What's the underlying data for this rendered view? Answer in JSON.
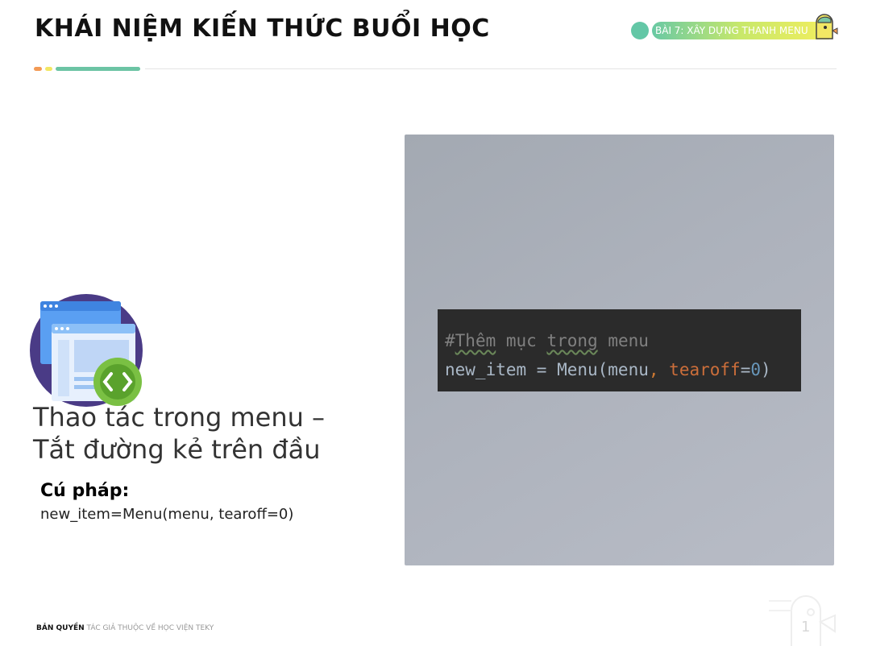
{
  "header": {
    "title": "KHÁI NIỆM KIẾN THỨC BUỔI HỌC",
    "lesson_tag": "BÀI 7: XÂY DỰNG THANH MENU"
  },
  "main": {
    "heading_line1": "Thao tác trong menu –",
    "heading_line2": "Tắt đường kẻ trên đầu",
    "syntax_label": "Cú pháp:",
    "syntax_code": "new_item=Menu(menu, tearoff=0)"
  },
  "code_block": {
    "line1_hash": "#",
    "line1_w1": "Thêm",
    "line1_w2": " mục ",
    "line1_w3": "trong",
    "line1_w4": " menu",
    "line2_a": "new_item = Menu(menu",
    "line2_comma": ",",
    "line2_kw": " tearoff",
    "line2_eq": "=",
    "line2_num": "0",
    "line2_close": ")"
  },
  "footer": {
    "bold": "BẢN QUYỀN",
    "rest": " TÁC GIẢ THUỘC VỀ HỌC VIỆN TEKY",
    "page_number": "1"
  },
  "colors": {
    "accent_orange": "#f39a55",
    "accent_yellow": "#f2e764",
    "accent_green": "#6cc4a4",
    "code_bg": "#2b2b2b",
    "panel_bg": "#adb2bc"
  },
  "icons": [
    "web-development-icon",
    "mascot-icon",
    "mascot-watermark-icon"
  ]
}
